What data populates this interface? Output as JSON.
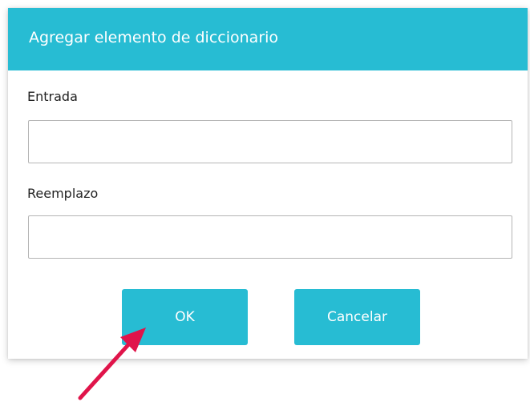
{
  "dialog": {
    "title": "Agregar elemento de diccionario",
    "header_color": "#27bcd3"
  },
  "fields": {
    "entrada": {
      "label": "Entrada",
      "value": "",
      "placeholder": ""
    },
    "reemplazo": {
      "label": "Reemplazo",
      "value": "",
      "placeholder": ""
    }
  },
  "buttons": {
    "ok_label": "OK",
    "cancel_label": "Cancelar",
    "color": "#27bcd3"
  },
  "annotation": {
    "icon": "red-pointer-arrow-icon",
    "color": "#e0144a",
    "target": "ok-button"
  }
}
